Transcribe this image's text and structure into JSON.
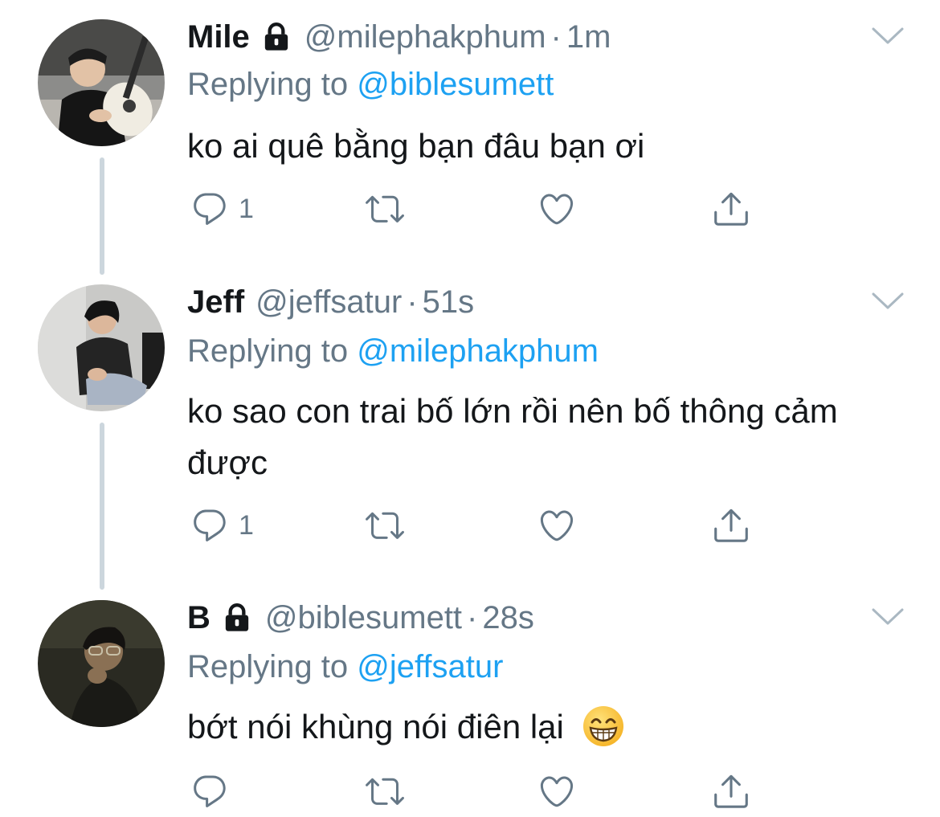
{
  "tweets": [
    {
      "name": "Mile",
      "protected": true,
      "handle": "@milephakphum",
      "separator": "·",
      "time": "1m",
      "replying_prefix": "Replying to",
      "replying_to": "@biblesumett",
      "text": "ko ai quê bằng bạn đâu bạn ơi",
      "reply_count": "1",
      "avatar_icon": "avatar-photo-guitar",
      "icons": [
        "reply-icon",
        "retweet-icon",
        "like-icon",
        "share-icon",
        "chevron-down-icon",
        "lock-icon"
      ]
    },
    {
      "name": "Jeff",
      "protected": false,
      "handle": "@jeffsatur",
      "separator": "·",
      "time": "51s",
      "replying_prefix": "Replying to",
      "replying_to": "@milephakphum",
      "text": "ko sao con trai bố lớn rồi nên bố thông cảm được",
      "reply_count": "1",
      "avatar_icon": "avatar-photo-sitting",
      "icons": [
        "reply-icon",
        "retweet-icon",
        "like-icon",
        "share-icon",
        "chevron-down-icon"
      ]
    },
    {
      "name": "B",
      "protected": true,
      "handle": "@biblesumett",
      "separator": "·",
      "time": "28s",
      "replying_prefix": "Replying to",
      "replying_to": "@jeffsatur",
      "text": "bớt nói khùng nói điên lại",
      "emoji": "grinning-face-with-smiling-eyes",
      "reply_count": "",
      "avatar_icon": "avatar-photo-dark",
      "icons": [
        "reply-icon",
        "retweet-icon",
        "like-icon",
        "share-icon",
        "chevron-down-icon",
        "lock-icon"
      ]
    }
  ],
  "colors": {
    "text_primary": "#14171a",
    "text_secondary": "#657786",
    "link": "#1da1f2",
    "thread_line": "#ccd6dd"
  }
}
